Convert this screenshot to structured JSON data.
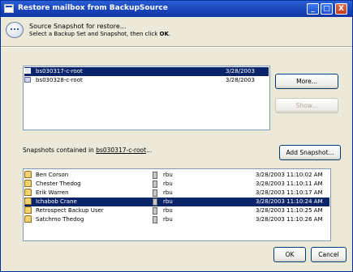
{
  "window": {
    "title": "Restore mailbox from BackupSource",
    "controls": {
      "minimize": "_",
      "maximize": "□",
      "close": "X"
    }
  },
  "header": {
    "line1": "Source Snapshot for restore...",
    "line2_prefix": "Select a Backup Set and Snapshot, then click ",
    "line2_bold": "OK",
    "line2_suffix": "."
  },
  "backup_sets": {
    "rows": [
      {
        "name": "bs030317-c-root",
        "date": "3/28/2003",
        "selected": true
      },
      {
        "name": "bs030328-c-root",
        "date": "3/28/2003",
        "selected": false
      }
    ],
    "more_button": "More...",
    "show_button": "Show..."
  },
  "snapshots": {
    "label_prefix": "Snapshots contained in ",
    "label_link": "bs030317-c-root",
    "label_suffix": "...",
    "add_button": "Add Snapshot...",
    "rows": [
      {
        "name": "Ben Corson",
        "owner": "rbu",
        "timestamp": "3/28/2003 11:10:02 AM",
        "selected": false
      },
      {
        "name": "Chester Thedog",
        "owner": "rbu",
        "timestamp": "3/28/2003 11:10:11 AM",
        "selected": false
      },
      {
        "name": "Erik Warren",
        "owner": "rbu",
        "timestamp": "3/28/2003 11:10:17 AM",
        "selected": false
      },
      {
        "name": "Ichabob Crane",
        "owner": "rbu",
        "timestamp": "3/28/2003 11:10:24 AM",
        "selected": true
      },
      {
        "name": "Retrospect Backup User",
        "owner": "rbu",
        "timestamp": "3/28/2003 11:10:25 AM",
        "selected": false
      },
      {
        "name": "Satchmo Thedog",
        "owner": "rbu",
        "timestamp": "3/28/2003 11:10:26 AM",
        "selected": false
      }
    ]
  },
  "footer": {
    "ok": "OK",
    "cancel": "Cancel"
  }
}
